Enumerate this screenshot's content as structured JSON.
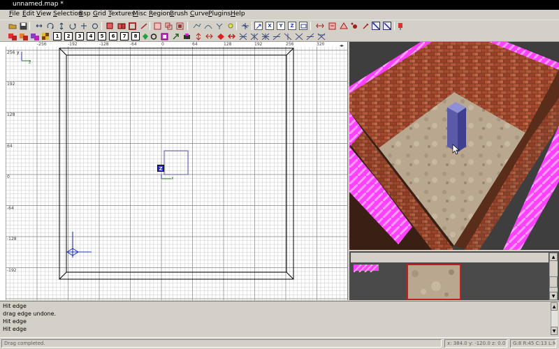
{
  "window": {
    "title": "unnamed.map *"
  },
  "menu": [
    {
      "label": "File"
    },
    {
      "label": "Edit"
    },
    {
      "label": "View"
    },
    {
      "label": "Selection"
    },
    {
      "label": "Bsp"
    },
    {
      "label": "Grid"
    },
    {
      "label": "Textures"
    },
    {
      "label": "Misc"
    },
    {
      "label": "Region"
    },
    {
      "label": "Brush"
    },
    {
      "label": "Curve"
    },
    {
      "label": "Plugins"
    },
    {
      "label": "Help"
    }
  ],
  "toolbar2_numbers": [
    "1",
    "2",
    "3",
    "4",
    "5",
    "6",
    "7",
    "8"
  ],
  "toolbar1_axis_buttons": [
    "X",
    "Y",
    "Z"
  ],
  "grid2d": {
    "top_ruler": [
      "-256",
      "-192",
      "-128",
      "-64",
      "0",
      "64",
      "128",
      "192",
      "256",
      "320"
    ],
    "left_ruler": [
      "256",
      "192",
      "128",
      "64",
      "0",
      "-64",
      "-128",
      "-192"
    ],
    "corner_axis_y": "y",
    "corner_axis_z": "z",
    "origin_marker": "Z",
    "origin_axis": "x"
  },
  "console": {
    "lines": [
      "Hit edge",
      "drag edge undone.",
      "Hit edge",
      "Hit edge"
    ]
  },
  "status": {
    "message": "Drag completed.",
    "coords": "x: 384.0  y: -120.0  z: 0.0",
    "grid_info": "G:8 R:45 C:13 L:MR"
  },
  "colors": {
    "selection_brush": "#5a5aa8",
    "caulk_pink": "#ff40ff",
    "grid_line": "#c8c8c8",
    "brush_outline": "#000000"
  }
}
